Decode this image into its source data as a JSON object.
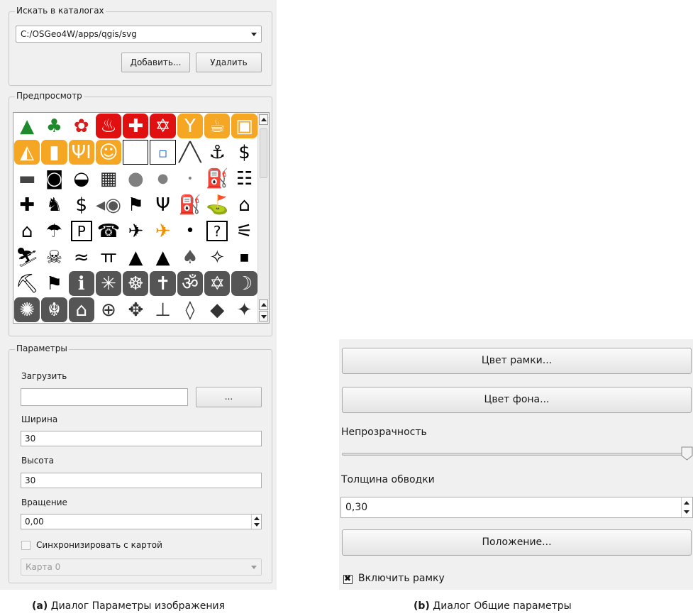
{
  "dialog_a": {
    "catalog_group": {
      "title": "Искать в каталогах",
      "path": "C:/OSGeo4W/apps/qgis/svg",
      "add_button": "Добавить...",
      "remove_button": "Удалить"
    },
    "preview_group": {
      "title": "Предпросмотр",
      "symbols": [
        {
          "name": "tree-conifer-icon",
          "glyph": "▲",
          "color": "#1e8a2c",
          "bg": ""
        },
        {
          "name": "tree-deciduous-icon",
          "glyph": "♣",
          "color": "#1e8a2c",
          "bg": ""
        },
        {
          "name": "flower-icon",
          "glyph": "✿",
          "color": "#d81b1b",
          "bg": ""
        },
        {
          "name": "fire-icon",
          "glyph": "♨",
          "color": "#ffffff",
          "bg": "#e01010"
        },
        {
          "name": "first-aid-icon",
          "glyph": "✚",
          "color": "#ffffff",
          "bg": "#e01010"
        },
        {
          "name": "star-of-david-red-icon",
          "glyph": "✡",
          "color": "#ffffff",
          "bg": "#e01010"
        },
        {
          "name": "cocktail-icon",
          "glyph": "Y",
          "color": "#ffffff",
          "bg": "#f5a623"
        },
        {
          "name": "cup-icon",
          "glyph": "☕",
          "color": "#ffffff",
          "bg": "#f5a623"
        },
        {
          "name": "film-icon",
          "glyph": "▣",
          "color": "#ffffff",
          "bg": "#f5a623"
        },
        {
          "name": "pizza-icon",
          "glyph": "◭",
          "color": "#ffffff",
          "bg": "#f5a623"
        },
        {
          "name": "bread-icon",
          "glyph": "▮",
          "color": "#ffffff",
          "bg": "#f5a623"
        },
        {
          "name": "restaurant-icon",
          "glyph": "ΨI",
          "color": "#ffffff",
          "bg": "#f5a623"
        },
        {
          "name": "ice-cream-icon",
          "glyph": "☺",
          "color": "#ffffff",
          "bg": "#f5a623"
        },
        {
          "name": "blank-square-icon",
          "glyph": "",
          "color": "#000000",
          "bg": ""
        },
        {
          "name": "small-square-icon",
          "glyph": "▫",
          "color": "#2a6bd1",
          "bg": ""
        },
        {
          "name": "line-icon",
          "glyph": "╱╲",
          "color": "#333333",
          "bg": ""
        },
        {
          "name": "anchor-icon",
          "glyph": "⚓",
          "color": "#000000",
          "bg": ""
        },
        {
          "name": "dollar-icon",
          "glyph": "$",
          "color": "#000000",
          "bg": ""
        },
        {
          "name": "knife-icon",
          "glyph": "▬",
          "color": "#444444",
          "bg": ""
        },
        {
          "name": "camera-icon",
          "glyph": "◙",
          "color": "#000000",
          "bg": ""
        },
        {
          "name": "car-icon",
          "glyph": "◒",
          "color": "#000000",
          "bg": ""
        },
        {
          "name": "building-icon",
          "glyph": "▦",
          "color": "#2a2a2a",
          "bg": ""
        },
        {
          "name": "large-circle-icon",
          "glyph": "●",
          "color": "#808080",
          "bg": ""
        },
        {
          "name": "medium-circle-icon",
          "glyph": "●",
          "color": "#808080",
          "bg": ""
        },
        {
          "name": "small-circle-icon",
          "glyph": "•",
          "color": "#808080",
          "bg": ""
        },
        {
          "name": "fuel-icon",
          "glyph": "⛽",
          "color": "#000000",
          "bg": ""
        },
        {
          "name": "toilets-icon",
          "glyph": "☷",
          "color": "#000000",
          "bg": ""
        },
        {
          "name": "hospital-cross-icon",
          "glyph": "✚",
          "color": "#000000",
          "bg": ""
        },
        {
          "name": "deer-icon",
          "glyph": "♞",
          "color": "#000000",
          "bg": ""
        },
        {
          "name": "dollar-bold-icon",
          "glyph": "$",
          "color": "#000000",
          "bg": ""
        },
        {
          "name": "fish-icon",
          "glyph": "◂◉",
          "color": "#555555",
          "bg": ""
        },
        {
          "name": "flag-small-icon",
          "glyph": "⚑",
          "color": "#000000",
          "bg": ""
        },
        {
          "name": "fork-knife-icon",
          "glyph": "Ψ",
          "color": "#000000",
          "bg": ""
        },
        {
          "name": "gas-pump-icon",
          "glyph": "⛽",
          "color": "#000000",
          "bg": ""
        },
        {
          "name": "golf-icon",
          "glyph": "⛳",
          "color": "#000000",
          "bg": ""
        },
        {
          "name": "hut-icon",
          "glyph": "⌂",
          "color": "#000000",
          "bg": ""
        },
        {
          "name": "house-icon",
          "glyph": "⌂",
          "color": "#000000",
          "bg": ""
        },
        {
          "name": "parachute-icon",
          "glyph": "☂",
          "color": "#000000",
          "bg": ""
        },
        {
          "name": "parking-icon",
          "glyph": "P",
          "color": "#000000",
          "bg": ""
        },
        {
          "name": "telephone-icon",
          "glyph": "☎",
          "color": "#000000",
          "bg": ""
        },
        {
          "name": "airport-icon",
          "glyph": "✈",
          "color": "#000000",
          "bg": ""
        },
        {
          "name": "airfield-icon",
          "glyph": "✈",
          "color": "#f08c00",
          "bg": ""
        },
        {
          "name": "dot-icon",
          "glyph": "•",
          "color": "#000000",
          "bg": ""
        },
        {
          "name": "question-icon",
          "glyph": "?",
          "color": "#000000",
          "bg": ""
        },
        {
          "name": "shipwreck-icon",
          "glyph": "⚟",
          "color": "#000000",
          "bg": ""
        },
        {
          "name": "ski-icon",
          "glyph": "⛷",
          "color": "#000000",
          "bg": ""
        },
        {
          "name": "skull-icon",
          "glyph": "☠",
          "color": "#000000",
          "bg": ""
        },
        {
          "name": "swimming-icon",
          "glyph": "≈",
          "color": "#000000",
          "bg": ""
        },
        {
          "name": "picnic-icon",
          "glyph": "ㅠ",
          "color": "#000000",
          "bg": ""
        },
        {
          "name": "tent-icon",
          "glyph": "▲",
          "color": "#000000",
          "bg": ""
        },
        {
          "name": "camping-icon",
          "glyph": "▲",
          "color": "#000000",
          "bg": ""
        },
        {
          "name": "forest-icon",
          "glyph": "♠",
          "color": "#555555",
          "bg": ""
        },
        {
          "name": "hiking-icon",
          "glyph": "✧",
          "color": "#000000",
          "bg": ""
        },
        {
          "name": "small-square-black-icon",
          "glyph": "■",
          "color": "#000000",
          "bg": ""
        },
        {
          "name": "mine-icon",
          "glyph": "⛏",
          "color": "#000000",
          "bg": ""
        },
        {
          "name": "flag-icon",
          "glyph": "⚑",
          "color": "#000000",
          "bg": ""
        },
        {
          "name": "info-icon",
          "glyph": "ℹ",
          "color": "#ffffff",
          "bg": "#555555"
        },
        {
          "name": "religion-icon",
          "glyph": "✳",
          "color": "#ffffff",
          "bg": "#555555"
        },
        {
          "name": "dharma-wheel-icon",
          "glyph": "☸",
          "color": "#ffffff",
          "bg": "#555555"
        },
        {
          "name": "christian-cross-icon",
          "glyph": "✝",
          "color": "#ffffff",
          "bg": "#555555"
        },
        {
          "name": "om-icon",
          "glyph": "ॐ",
          "color": "#ffffff",
          "bg": "#555555"
        },
        {
          "name": "star-of-david-icon",
          "glyph": "✡",
          "color": "#ffffff",
          "bg": "#555555"
        },
        {
          "name": "crescent-icon",
          "glyph": "☽",
          "color": "#ffffff",
          "bg": "#555555"
        },
        {
          "name": "bahai-icon",
          "glyph": "✺",
          "color": "#ffffff",
          "bg": "#555555"
        },
        {
          "name": "khanda-icon",
          "glyph": "☬",
          "color": "#ffffff",
          "bg": "#555555"
        },
        {
          "name": "museum-icon",
          "glyph": "⌂",
          "color": "#ffffff",
          "bg": "#555555"
        },
        {
          "name": "compass-rose-icon",
          "glyph": "⊕",
          "color": "#333333",
          "bg": ""
        },
        {
          "name": "north-arrow-compass-icon",
          "glyph": "✥",
          "color": "#333333",
          "bg": ""
        },
        {
          "name": "north-arrow-l-icon",
          "glyph": "⊥",
          "color": "#333333",
          "bg": ""
        },
        {
          "name": "north-arrow-diamond-icon",
          "glyph": "◊",
          "color": "#333333",
          "bg": ""
        },
        {
          "name": "north-arrow-diamond2-icon",
          "glyph": "◆",
          "color": "#333333",
          "bg": ""
        },
        {
          "name": "north-arrow-cross-icon",
          "glyph": "✦",
          "color": "#333333",
          "bg": ""
        },
        {
          "name": "north-arrow-angle-icon",
          "glyph": "⟂",
          "color": "#333333",
          "bg": ""
        }
      ]
    },
    "params_group": {
      "title": "Параметры",
      "load_label": "Загрузить",
      "load_value": "",
      "browse_button": "...",
      "width_label": "Ширина",
      "width_value": "30",
      "height_label": "Высота",
      "height_value": "30",
      "rotation_label": "Вращение",
      "rotation_value": "0,00",
      "sync_label": "Синхронизировать с картой",
      "map_select": "Карта 0"
    }
  },
  "dialog_b": {
    "frame_color_button": "Цвет рамки...",
    "background_color_button": "Цвет фона...",
    "opacity_label": "Непрозрачность",
    "opacity_value": 1.0,
    "stroke_width_label": "Толщина обводки",
    "stroke_width_value": "0,30",
    "position_button": "Положение...",
    "enable_frame_label": "Включить рамку",
    "enable_frame_checked": true
  },
  "captions": {
    "a_prefix": "(a)",
    "a_text": "Диалог Параметры изображения",
    "b_prefix": "(b)",
    "b_text": "Диалог Общие параметры"
  }
}
